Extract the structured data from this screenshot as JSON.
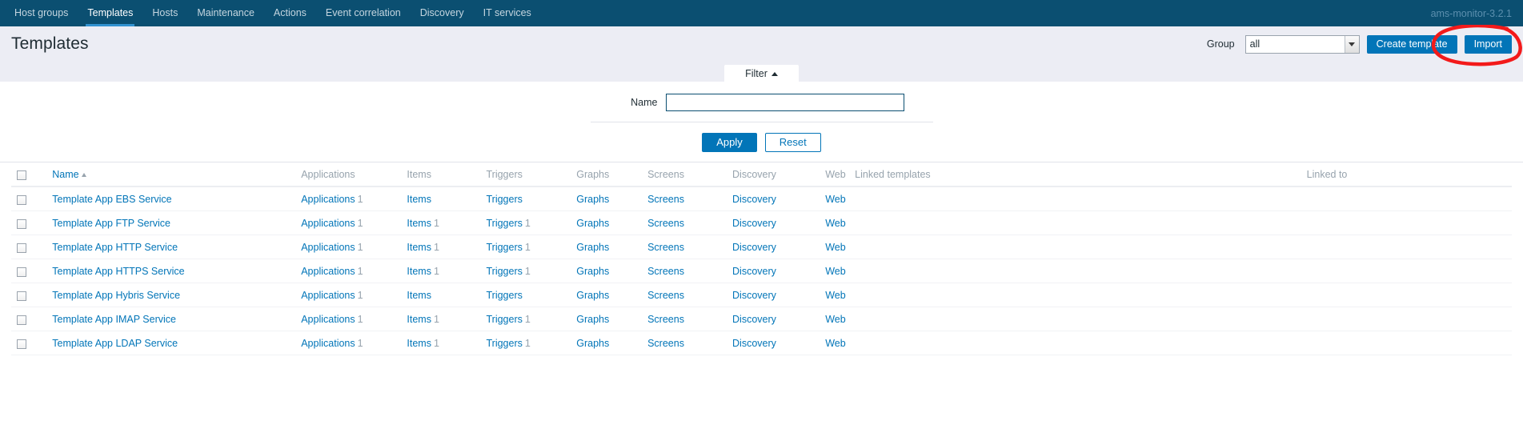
{
  "nav": {
    "items": [
      {
        "label": "Host groups",
        "active": false
      },
      {
        "label": "Templates",
        "active": true
      },
      {
        "label": "Hosts",
        "active": false
      },
      {
        "label": "Maintenance",
        "active": false
      },
      {
        "label": "Actions",
        "active": false
      },
      {
        "label": "Event correlation",
        "active": false
      },
      {
        "label": "Discovery",
        "active": false
      },
      {
        "label": "IT services",
        "active": false
      }
    ],
    "version": "ams-monitor-3.2.1"
  },
  "header": {
    "title": "Templates",
    "group_label": "Group",
    "group_value": "all",
    "create_template_label": "Create template",
    "import_label": "Import",
    "annotation_color": "#f31a1a"
  },
  "filter": {
    "tab_label": "Filter",
    "name_label": "Name",
    "name_value": "",
    "name_placeholder": "",
    "apply_label": "Apply",
    "reset_label": "Reset"
  },
  "table": {
    "columns": {
      "name": "Name",
      "applications": "Applications",
      "items": "Items",
      "triggers": "Triggers",
      "graphs": "Graphs",
      "screens": "Screens",
      "discovery": "Discovery",
      "web": "Web",
      "linked_templates": "Linked templates",
      "linked_to": "Linked to"
    },
    "rows": [
      {
        "name": "Template App EBS Service",
        "applications": "Applications",
        "applications_count": "1",
        "items": "Items",
        "items_count": "",
        "triggers": "Triggers",
        "triggers_count": "",
        "graphs": "Graphs",
        "graphs_count": "",
        "screens": "Screens",
        "screens_count": "",
        "discovery": "Discovery",
        "discovery_count": "",
        "web": "Web",
        "web_count": "",
        "linked_templates": "",
        "linked_to": ""
      },
      {
        "name": "Template App FTP Service",
        "applications": "Applications",
        "applications_count": "1",
        "items": "Items",
        "items_count": "1",
        "triggers": "Triggers",
        "triggers_count": "1",
        "graphs": "Graphs",
        "graphs_count": "",
        "screens": "Screens",
        "screens_count": "",
        "discovery": "Discovery",
        "discovery_count": "",
        "web": "Web",
        "web_count": "",
        "linked_templates": "",
        "linked_to": ""
      },
      {
        "name": "Template App HTTP Service",
        "applications": "Applications",
        "applications_count": "1",
        "items": "Items",
        "items_count": "1",
        "triggers": "Triggers",
        "triggers_count": "1",
        "graphs": "Graphs",
        "graphs_count": "",
        "screens": "Screens",
        "screens_count": "",
        "discovery": "Discovery",
        "discovery_count": "",
        "web": "Web",
        "web_count": "",
        "linked_templates": "",
        "linked_to": ""
      },
      {
        "name": "Template App HTTPS Service",
        "applications": "Applications",
        "applications_count": "1",
        "items": "Items",
        "items_count": "1",
        "triggers": "Triggers",
        "triggers_count": "1",
        "graphs": "Graphs",
        "graphs_count": "",
        "screens": "Screens",
        "screens_count": "",
        "discovery": "Discovery",
        "discovery_count": "",
        "web": "Web",
        "web_count": "",
        "linked_templates": "",
        "linked_to": ""
      },
      {
        "name": "Template App Hybris Service",
        "applications": "Applications",
        "applications_count": "1",
        "items": "Items",
        "items_count": "",
        "triggers": "Triggers",
        "triggers_count": "",
        "graphs": "Graphs",
        "graphs_count": "",
        "screens": "Screens",
        "screens_count": "",
        "discovery": "Discovery",
        "discovery_count": "",
        "web": "Web",
        "web_count": "",
        "linked_templates": "",
        "linked_to": ""
      },
      {
        "name": "Template App IMAP Service",
        "applications": "Applications",
        "applications_count": "1",
        "items": "Items",
        "items_count": "1",
        "triggers": "Triggers",
        "triggers_count": "1",
        "graphs": "Graphs",
        "graphs_count": "",
        "screens": "Screens",
        "screens_count": "",
        "discovery": "Discovery",
        "discovery_count": "",
        "web": "Web",
        "web_count": "",
        "linked_templates": "",
        "linked_to": ""
      },
      {
        "name": "Template App LDAP Service",
        "applications": "Applications",
        "applications_count": "1",
        "items": "Items",
        "items_count": "1",
        "triggers": "Triggers",
        "triggers_count": "1",
        "graphs": "Graphs",
        "graphs_count": "",
        "screens": "Screens",
        "screens_count": "",
        "discovery": "Discovery",
        "discovery_count": "",
        "web": "Web",
        "web_count": "",
        "linked_templates": "",
        "linked_to": ""
      }
    ]
  }
}
